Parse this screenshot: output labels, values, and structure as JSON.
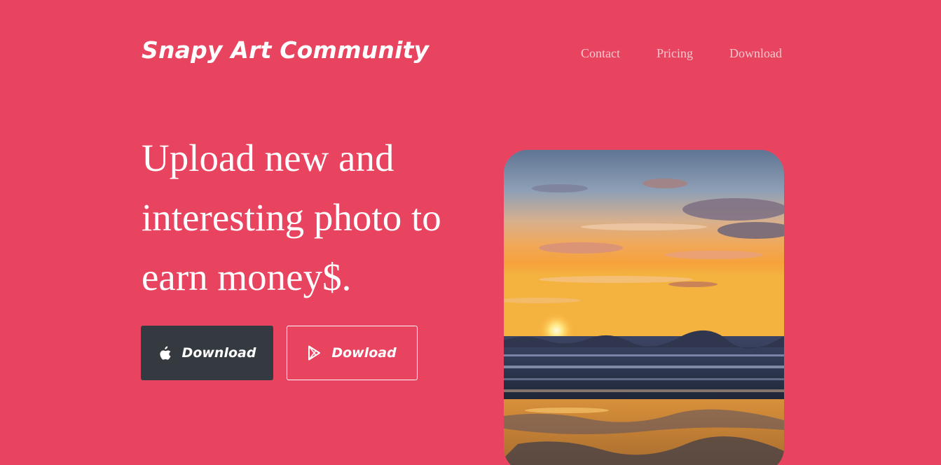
{
  "header": {
    "brand": "Snapy Art Community",
    "nav": [
      "Contact",
      "Pricing",
      "Download"
    ]
  },
  "hero": {
    "headline": "Upload new and interesting photo to earn money$.",
    "buttons": {
      "apple": {
        "label": "Download",
        "icon": "apple-icon"
      },
      "play": {
        "label": "Dowload",
        "icon": "google-play-icon"
      }
    },
    "image": {
      "subject": "sunset-over-ocean-beach-photo"
    }
  },
  "colors": {
    "background": "#e8445f",
    "apple_button": "#353a40",
    "text": "#ffffff",
    "nav_text": "#f6c9cf"
  }
}
